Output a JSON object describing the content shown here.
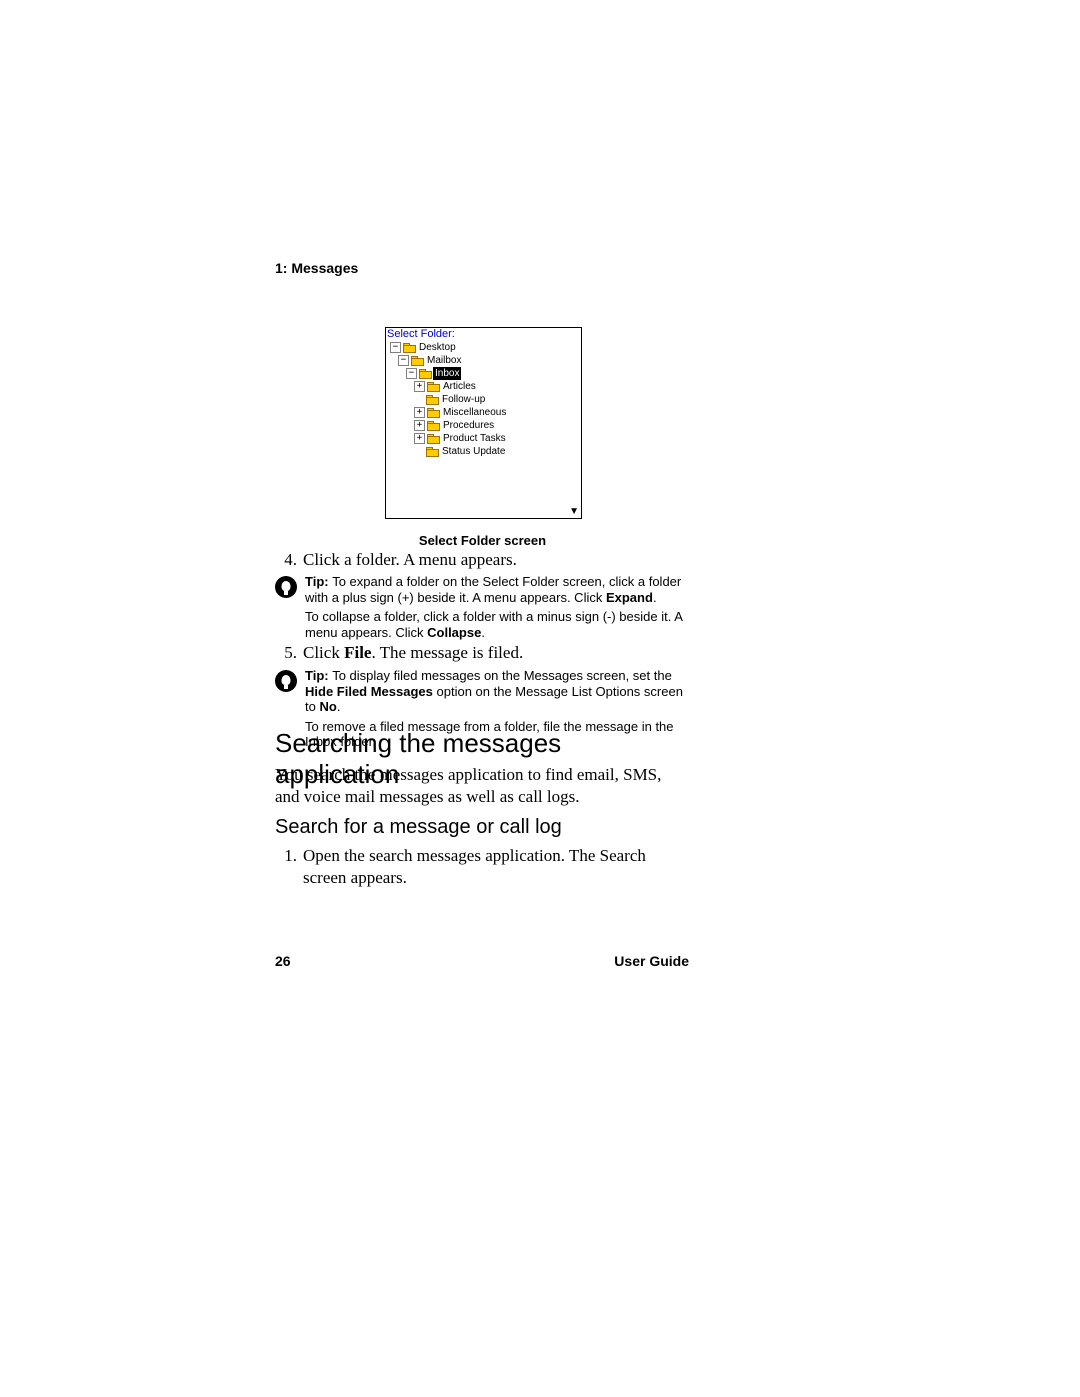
{
  "header": {
    "section_label": "1: Messages"
  },
  "screenshot": {
    "title": "Select Folder:",
    "tree": {
      "desktop": {
        "toggle": "−",
        "label": "Desktop"
      },
      "mailbox": {
        "toggle": "−",
        "label": "Mailbox"
      },
      "inbox": {
        "toggle": "−",
        "label": "Inbox"
      },
      "articles": {
        "toggle": "+",
        "label": "Articles"
      },
      "followup": {
        "toggle": "",
        "label": "Follow-up"
      },
      "miscellaneous": {
        "toggle": "+",
        "label": "Miscellaneous"
      },
      "procedures": {
        "toggle": "+",
        "label": "Procedures"
      },
      "producttasks": {
        "toggle": "+",
        "label": "Product Tasks"
      },
      "statusupdate": {
        "toggle": "",
        "label": "Status Update"
      }
    }
  },
  "caption": "Select Folder screen",
  "steps": {
    "s4": {
      "num": "4.",
      "text": "Click a folder. A menu appears."
    },
    "s5": {
      "num": "5.",
      "prefix": "Click ",
      "bold": "File",
      "suffix": ". The message is filed."
    },
    "s1": {
      "num": "1.",
      "text": "Open the search messages application. The Search screen appears."
    }
  },
  "tips": {
    "t1": {
      "label": "Tip: ",
      "p1a": "To expand a folder on the Select Folder screen, click a folder with a plus sign (+) beside it. A menu appears. Click ",
      "p1b_bold": "Expand",
      "p1c": ".",
      "p2a": "To collapse a folder, click a folder with a minus sign (-) beside it. A menu appears. Click ",
      "p2b_bold": "Collapse",
      "p2c": "."
    },
    "t2": {
      "label": "Tip: ",
      "p1a": "To display filed messages on the Messages screen, set the ",
      "p1b_bold": "Hide Filed Messages",
      "p1c": " option on the Message List Options screen to ",
      "p1d_bold": "No",
      "p1e": ".",
      "p2": "To remove a filed message from a folder, file the message in the Inbox folder."
    }
  },
  "headings": {
    "h1": "Searching the messages application",
    "h2": "Search for a message or call log"
  },
  "body_para": "You search the messages application to find email, SMS, and voice mail messages as well as call logs.",
  "footer": {
    "page_number": "26",
    "doc_title": "User Guide"
  }
}
